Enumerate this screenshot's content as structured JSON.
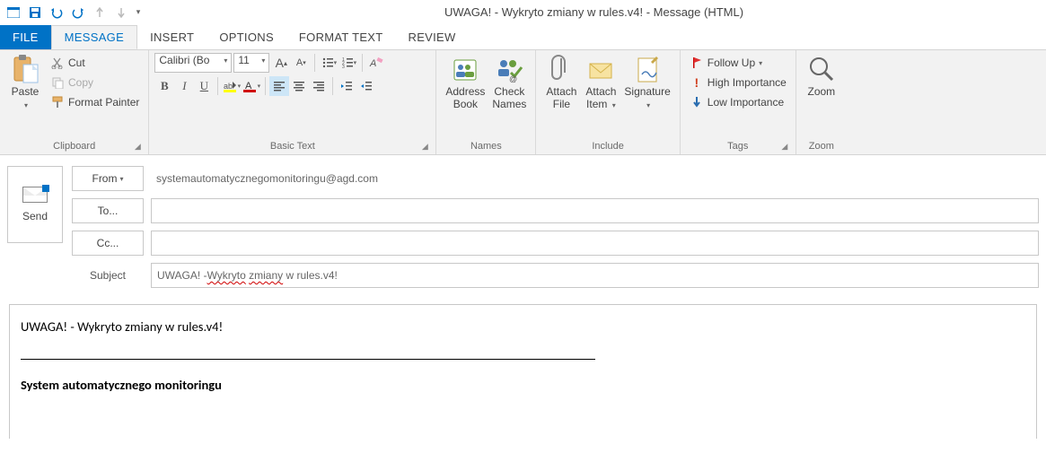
{
  "window": {
    "title": "UWAGA! - Wykryto zmiany w rules.v4! - Message (HTML)"
  },
  "tabs": {
    "file": "FILE",
    "message": "MESSAGE",
    "insert": "INSERT",
    "options": "OPTIONS",
    "format_text": "FORMAT TEXT",
    "review": "REVIEW"
  },
  "ribbon": {
    "clipboard": {
      "label": "Clipboard",
      "paste": "Paste",
      "cut": "Cut",
      "copy": "Copy",
      "format_painter": "Format Painter"
    },
    "basic_text": {
      "label": "Basic Text",
      "font_name": "Calibri (Bo",
      "font_size": "11"
    },
    "names": {
      "label": "Names",
      "address_book": "Address\nBook",
      "check_names": "Check\nNames"
    },
    "include": {
      "label": "Include",
      "attach_file": "Attach\nFile",
      "attach_item": "Attach\nItem",
      "signature": "Signature"
    },
    "tags": {
      "label": "Tags",
      "follow_up": "Follow Up",
      "high": "High Importance",
      "low": "Low Importance"
    },
    "zoom": {
      "label": "Zoom",
      "zoom": "Zoom"
    }
  },
  "compose": {
    "send": "Send",
    "from_btn": "From",
    "from_value": "systemautomatycznegomonitoringu@agd.com",
    "to_btn": "To...",
    "cc_btn": "Cc...",
    "subject_label": "Subject",
    "subject_value": "UWAGA! - Wykryto zmiany w rules.v4!"
  },
  "body": {
    "line1": "UWAGA! - Wykryto zmiany w rules.v4!",
    "signature": "System automatycznego monitoringu"
  }
}
